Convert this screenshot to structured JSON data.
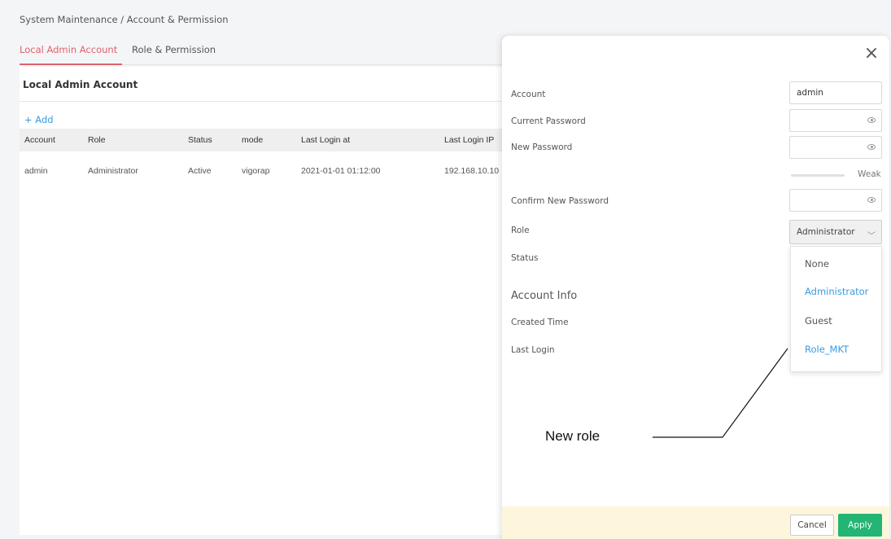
{
  "breadcrumb": "System Maintenance / Account & Permission",
  "tabs": [
    {
      "label": "Local Admin Account",
      "active": true
    },
    {
      "label": "Role & Permission",
      "active": false
    }
  ],
  "card": {
    "title": "Local Admin Account",
    "add_label": "+ Add",
    "columns": [
      "Account",
      "Role",
      "Status",
      "mode",
      "Last Login at",
      "Last Login IP"
    ],
    "rows": [
      [
        "admin",
        "Administrator",
        "Active",
        "vigorap",
        "2021-01-01 01:12:00",
        "192.168.10.10"
      ]
    ]
  },
  "drawer": {
    "close_icon": "×",
    "fields": {
      "account_label": "Account",
      "account_value": "admin",
      "current_password_label": "Current Password",
      "new_password_label": "New Password",
      "strength_label": "Weak",
      "confirm_password_label": "Confirm New Password",
      "role_label": "Role",
      "role_value": "Administrator",
      "status_label": "Status"
    },
    "role_options": [
      "None",
      "Administrator",
      "Guest",
      "Role_MKT"
    ],
    "account_info": {
      "title": "Account Info",
      "created_time_label": "Created Time",
      "last_login_label": "Last Login"
    },
    "buttons": {
      "cancel": "Cancel",
      "apply": "Apply"
    }
  },
  "annotation": {
    "label": "New role"
  },
  "colors": {
    "accent_tab": "#e0626c",
    "link_blue": "#3b9be0",
    "apply_green": "#22b573",
    "footer_bg": "#fdf6dc"
  },
  "icons": [
    "close-icon",
    "eye-icon",
    "chevron-down-icon"
  ]
}
